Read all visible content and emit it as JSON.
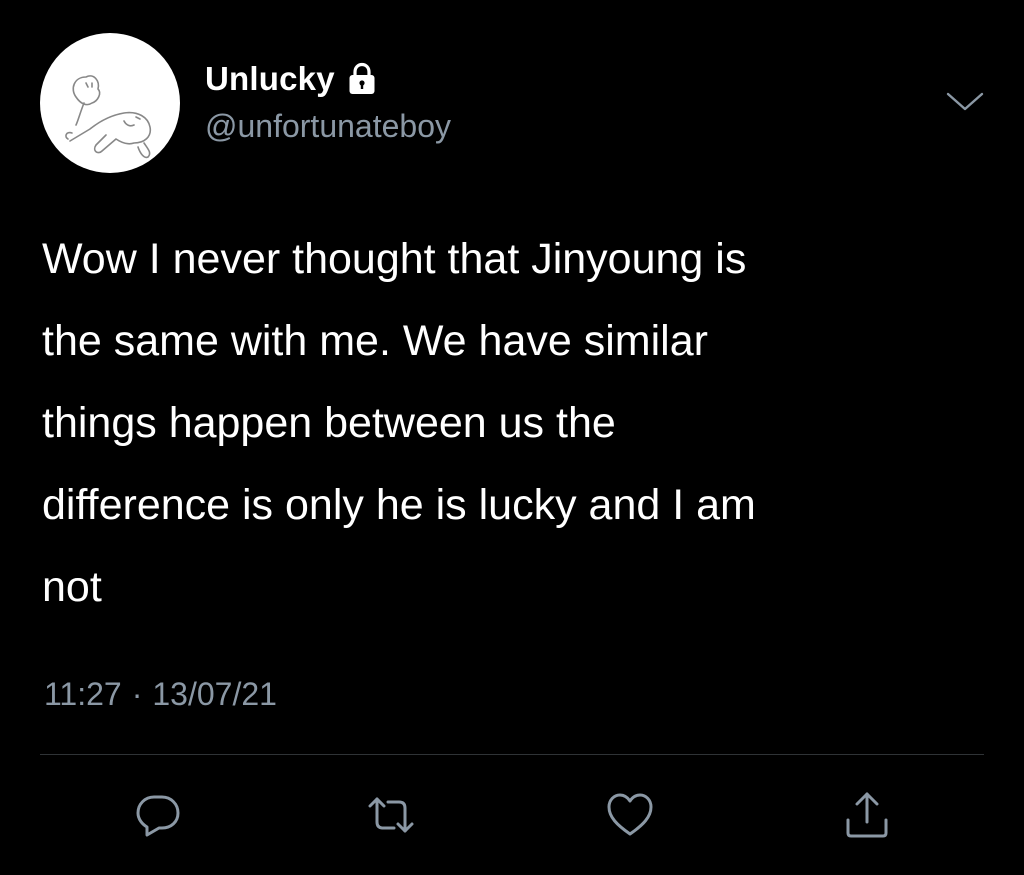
{
  "user": {
    "display_name": "Unlucky",
    "handle": "@unfortunateboy",
    "protected_icon": "lock-icon",
    "avatar_icon": "cartoon-character-avatar"
  },
  "tweet": {
    "text": "Wow I never thought that Jinyoung is\nthe same with me. We have similar\nthings happen between us the\ndifference is only he is lucky and I am\nnot",
    "time": "11:27",
    "separator": "·",
    "date": "13/07/21"
  },
  "menu": {
    "icon": "chevron-down-icon"
  },
  "actions": [
    {
      "name": "reply",
      "icon": "comment-icon"
    },
    {
      "name": "retweet",
      "icon": "retweet-icon"
    },
    {
      "name": "like",
      "icon": "heart-icon"
    },
    {
      "name": "share",
      "icon": "share-icon"
    }
  ],
  "colors": {
    "background": "#000000",
    "primary_text": "#ffffff",
    "secondary_text": "#8b98a5",
    "divider": "#2f3336"
  }
}
